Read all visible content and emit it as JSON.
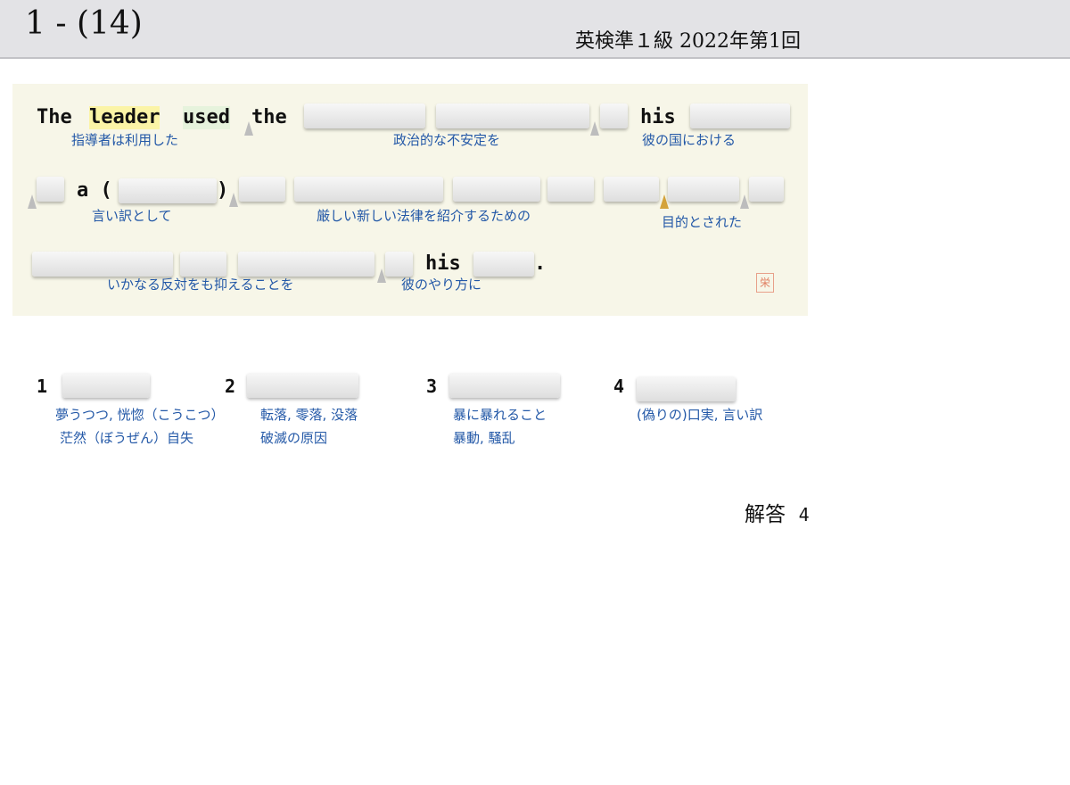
{
  "header": {
    "question_number": "1 - (14)",
    "exam_label": "英検準１級  2022年第1回"
  },
  "sentence": {
    "words": [
      "The",
      "leader",
      "used",
      "the",
      "his",
      "a (",
      ")",
      "his",
      "."
    ],
    "glosses": [
      "指導者は利用した",
      "政治的な不安定を",
      "彼の国における",
      "言い訳として",
      "厳しい新しい法律を紹介するための",
      "目的とされた",
      "いかなる反対をも抑えることを",
      "彼のやり方に"
    ],
    "seal_char": "栄"
  },
  "options": [
    {
      "number": "1",
      "gloss_1": "夢うつつ, 恍惚（こうこつ）",
      "gloss_2": "茫然（ぼうぜん）自失"
    },
    {
      "number": "2",
      "gloss_1": "転落, 零落, 没落",
      "gloss_2": "破滅の原因"
    },
    {
      "number": "3",
      "gloss_1": "暴に暴れること",
      "gloss_2": "暴動, 騒乱"
    },
    {
      "number": "4",
      "gloss_1": "(偽りの)口実, 言い訳",
      "gloss_2": ""
    }
  ],
  "answer": {
    "label": "解答",
    "value": "4"
  },
  "colors": {
    "gloss": "#2358a7",
    "highlight_yellow": "#fbf4a6",
    "highlight_green": "#e6f3dc",
    "card_bg": "#f7f6e8",
    "header_bg": "#e3e3e6"
  }
}
